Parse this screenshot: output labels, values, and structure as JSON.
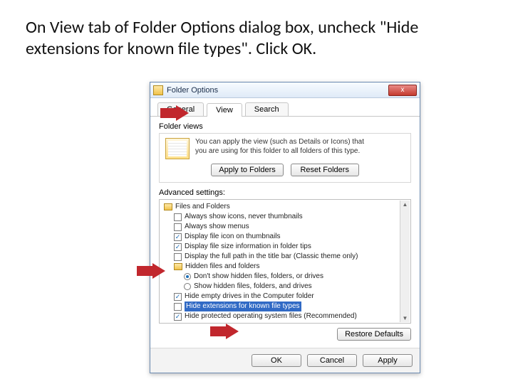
{
  "instruction": "On View tab of Folder Options dialog box, uncheck \"Hide extensions for known file types\". Click OK.",
  "dialog": {
    "title": "Folder Options",
    "close_glyph": "x",
    "tabs": {
      "general": "General",
      "view": "View",
      "search": "Search"
    },
    "folder_views": {
      "label": "Folder views",
      "desc_line1": "You can apply the view (such as Details or Icons) that",
      "desc_line2": "you are using for this folder to all folders of this type.",
      "apply": "Apply to Folders",
      "reset": "Reset Folders"
    },
    "advanced_label": "Advanced settings:",
    "tree": {
      "root": "Files and Folders",
      "items": [
        {
          "label": "Always show icons, never thumbnails",
          "checked": false
        },
        {
          "label": "Always show menus",
          "checked": false
        },
        {
          "label": "Display file icon on thumbnails",
          "checked": true
        },
        {
          "label": "Display file size information in folder tips",
          "checked": true
        },
        {
          "label": "Display the full path in the title bar (Classic theme only)",
          "checked": false
        }
      ],
      "hidden_group": "Hidden files and folders",
      "radios": [
        {
          "label": "Don't show hidden files, folders, or drives",
          "selected": true
        },
        {
          "label": "Show hidden files, folders, and drives",
          "selected": false
        }
      ],
      "tail": [
        {
          "label": "Hide empty drives in the Computer folder",
          "checked": true
        },
        {
          "label": "Hide extensions for known file types",
          "checked": false,
          "highlight": true
        },
        {
          "label": "Hide protected operating system files (Recommended)",
          "checked": true
        }
      ]
    },
    "restore": "Restore Defaults",
    "buttons": {
      "ok": "OK",
      "cancel": "Cancel",
      "apply": "Apply"
    }
  }
}
